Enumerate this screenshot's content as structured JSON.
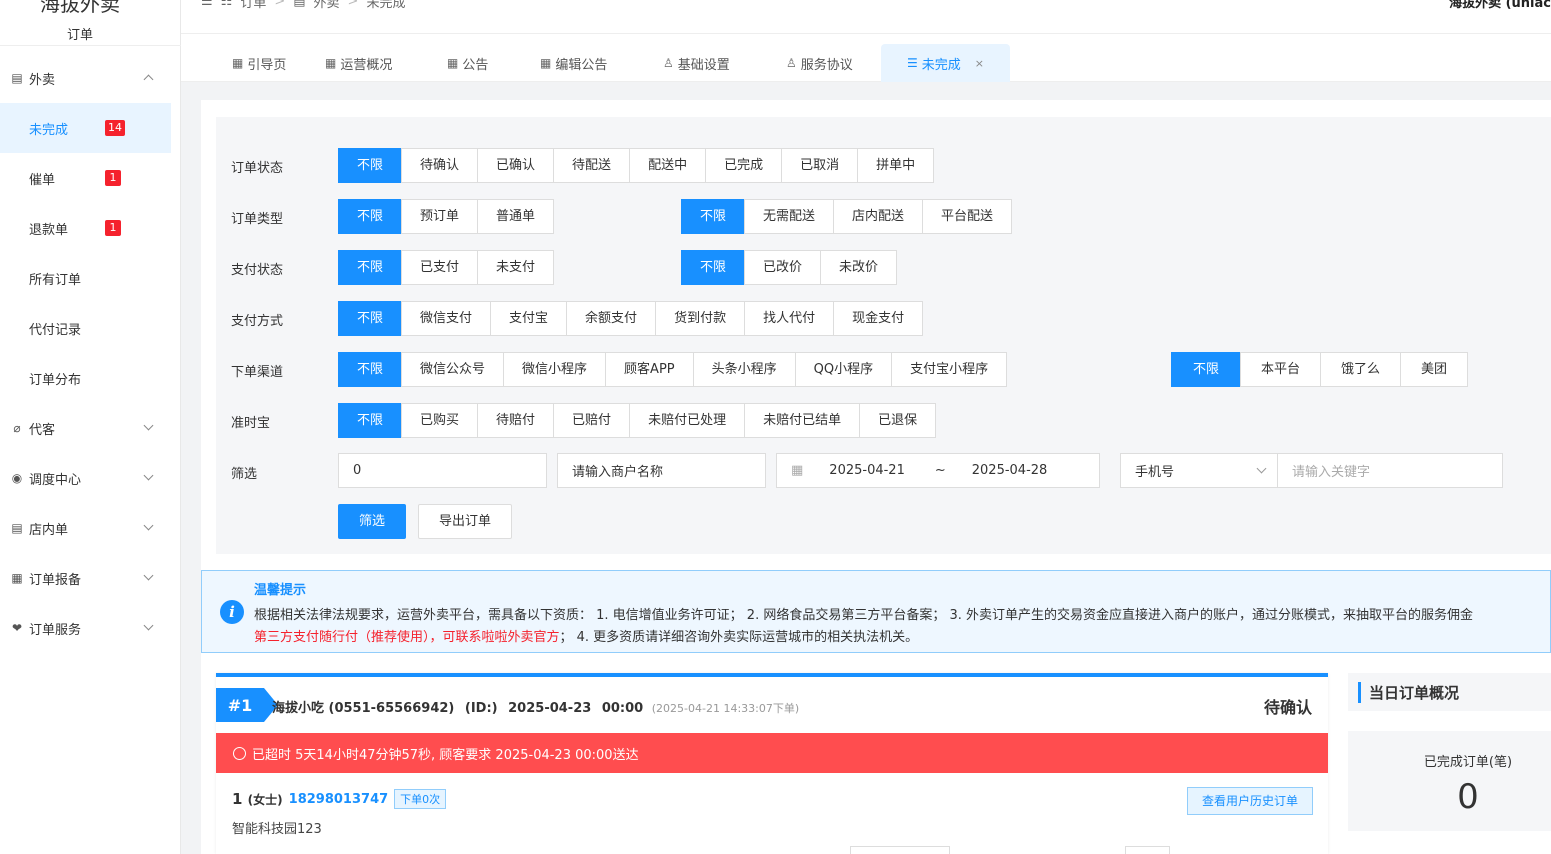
{
  "sidebar": {
    "brand": "海拔外卖",
    "brand_sub": "订单",
    "groups": [
      {
        "label": "外卖",
        "icon": "document-icon"
      },
      {
        "label": "代客",
        "icon": "paperclip-icon"
      },
      {
        "label": "调度中心",
        "icon": "location-icon"
      },
      {
        "label": "店内单",
        "icon": "document-icon"
      },
      {
        "label": "订单报备",
        "icon": "report-icon"
      },
      {
        "label": "订单服务",
        "icon": "heart-hand-icon"
      }
    ],
    "items": [
      {
        "label": "未完成",
        "badge": "14"
      },
      {
        "label": "催单",
        "badge": "1"
      },
      {
        "label": "退款单",
        "badge": "1"
      },
      {
        "label": "所有订单"
      },
      {
        "label": "代付记录"
      },
      {
        "label": "订单分布"
      }
    ]
  },
  "header": {
    "breadcrumb": [
      "订单",
      "外卖",
      "未完成"
    ],
    "user": "海拔外卖 (uniac"
  },
  "tabs": [
    {
      "label": "引导页",
      "icon": "grid-icon"
    },
    {
      "label": "运营概况",
      "icon": "grid-icon"
    },
    {
      "label": "公告",
      "icon": "grid-icon"
    },
    {
      "label": "编辑公告",
      "icon": "grid-icon"
    },
    {
      "label": "基础设置",
      "icon": "user-icon"
    },
    {
      "label": "服务协议",
      "icon": "user-icon"
    },
    {
      "label": "未完成",
      "icon": "list-icon",
      "close": "×"
    }
  ],
  "filters": {
    "order_status": {
      "label": "订单状态",
      "options": [
        "不限",
        "待确认",
        "已确认",
        "待配送",
        "配送中",
        "已完成",
        "已取消",
        "拼单中"
      ]
    },
    "order_type": {
      "label": "订单类型",
      "options": [
        "不限",
        "预订单",
        "普通单"
      ]
    },
    "delivery": {
      "options": [
        "不限",
        "无需配送",
        "店内配送",
        "平台配送"
      ]
    },
    "pay_status": {
      "label": "支付状态",
      "options": [
        "不限",
        "已支付",
        "未支付"
      ]
    },
    "price_change": {
      "options": [
        "不限",
        "已改价",
        "未改价"
      ]
    },
    "pay_method": {
      "label": "支付方式",
      "options": [
        "不限",
        "微信支付",
        "支付宝",
        "余额支付",
        "货到付款",
        "找人代付",
        "现金支付"
      ]
    },
    "channel": {
      "label": "下单渠道",
      "options": [
        "不限",
        "微信公众号",
        "微信小程序",
        "顾客APP",
        "头条小程序",
        "QQ小程序",
        "支付宝小程序"
      ]
    },
    "platform": {
      "options": [
        "不限",
        "本平台",
        "饿了么",
        "美团"
      ]
    },
    "ontime": {
      "label": "准时宝",
      "options": [
        "不限",
        "已购买",
        "待赔付",
        "已赔付",
        "未赔付已处理",
        "未赔付已结单",
        "已退保"
      ]
    },
    "screen": {
      "label": "筛选",
      "id_value": "0",
      "merchant_placeholder": "请输入商户名称",
      "date_start": "2025-04-21",
      "date_sep": "~",
      "date_end": "2025-04-28",
      "field_select": "手机号",
      "keyword_placeholder": "请输入关键字"
    },
    "btn_filter": "筛选",
    "btn_export": "导出订单"
  },
  "tip": {
    "title": "温馨提示",
    "line1": "根据相关法律法规要求，运营外卖平台，需具备以下资质： 1. 电信增值业务许可证； 2. 网络食品交易第三方平台备案； 3. 外卖订单产生的交易资金应直接进入商户的账户，通过分账模式，来抽取平台的服务佣金",
    "line2_red": "第三方支付随行付（推荐使用），可联系啦啦外卖官方",
    "line2_rest": "； 4. 更多资质请详细咨询外卖实际运营城市的相关执法机关。"
  },
  "order": {
    "num": "#1",
    "shop": "海拔小吃 (0551-65566942)",
    "id": "(ID:)",
    "deliver_date": "2025-04-23",
    "deliver_time": "00:00",
    "created": "(2025-04-21 14:33:07下单)",
    "status": "待确认",
    "alert": "已超时 5天14小时47分钟57秒, 顾客要求 2025-04-23 00:00送达",
    "cust_name": "1",
    "cust_gender": "(女士)",
    "cust_phone": "18298013747",
    "cust_tag": "下单0次",
    "history_btn": "查看用户历史订单",
    "address": "智能科技园123"
  },
  "today": {
    "title": "当日订单概况",
    "done_label": "已完成订单(笔)",
    "done_value": "0"
  },
  "colors": {
    "accent": "#1890ff",
    "alert": "#ff4d4f",
    "badge": "#f5222d"
  }
}
